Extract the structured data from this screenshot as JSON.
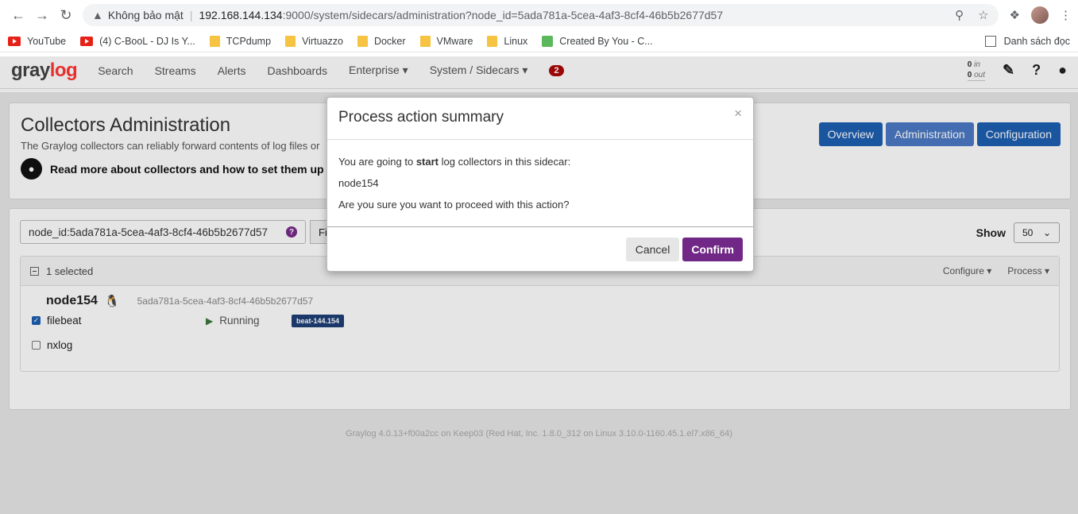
{
  "browser": {
    "warning_text": "Không bảo mật",
    "url_host": "192.168.144.134",
    "url_path": ":9000/system/sidecars/administration?node_id=5ada781a-5cea-4af3-8cf4-46b5b2677d57",
    "bookmarks": [
      "YouTube",
      "(4) C-BooL - DJ Is Y...",
      "TCPdump",
      "Virtuazzo",
      "Docker",
      "VMware",
      "Linux",
      "Created By You - C..."
    ],
    "reading_list": "Danh sách đọc"
  },
  "navbar": {
    "logo_a": "gray",
    "logo_b": "log",
    "items": [
      "Search",
      "Streams",
      "Alerts",
      "Dashboards",
      "Enterprise ▾",
      "System / Sidecars ▾"
    ],
    "notification_count": "2",
    "throughput_in": "0",
    "throughput_in_label": "in",
    "throughput_out": "0",
    "throughput_out_label": "out"
  },
  "header": {
    "title": "Collectors Administration",
    "subtitle": "The Graylog collectors can reliably forward contents of log files or",
    "read_more": "Read more about collectors and how to set them up in t",
    "buttons": [
      "Overview",
      "Administration",
      "Configuration"
    ]
  },
  "list": {
    "filter_value": "node_id:5ada781a-5cea-4af3-8cf4-46b5b2677d57",
    "filter_button": "Fi",
    "show_label": "Show",
    "show_value": "50",
    "selected_text": "1 selected",
    "configure_label": "Configure ▾",
    "process_label": "Process ▾",
    "node_name": "node154",
    "node_id": "5ada781a-5cea-4af3-8cf4-46b5b2677d57",
    "collectors": [
      {
        "name": "filebeat",
        "checked": true,
        "status": "Running",
        "config": "beat-144.154"
      },
      {
        "name": "nxlog",
        "checked": false,
        "status": "",
        "config": ""
      }
    ]
  },
  "footer": "Graylog 4.0.13+f00a2cc on Keep03 (Red Hat, Inc. 1.8.0_312 on Linux 3.10.0-1160.45.1.el7.x86_64)",
  "modal": {
    "title": "Process action summary",
    "close": "×",
    "line1_pre": "You are going to ",
    "line1_action": "start",
    "line1_post": " log collectors in this sidecar:",
    "node": "node154",
    "question": "Are you sure you want to proceed with this action?",
    "cancel": "Cancel",
    "confirm": "Confirm"
  }
}
